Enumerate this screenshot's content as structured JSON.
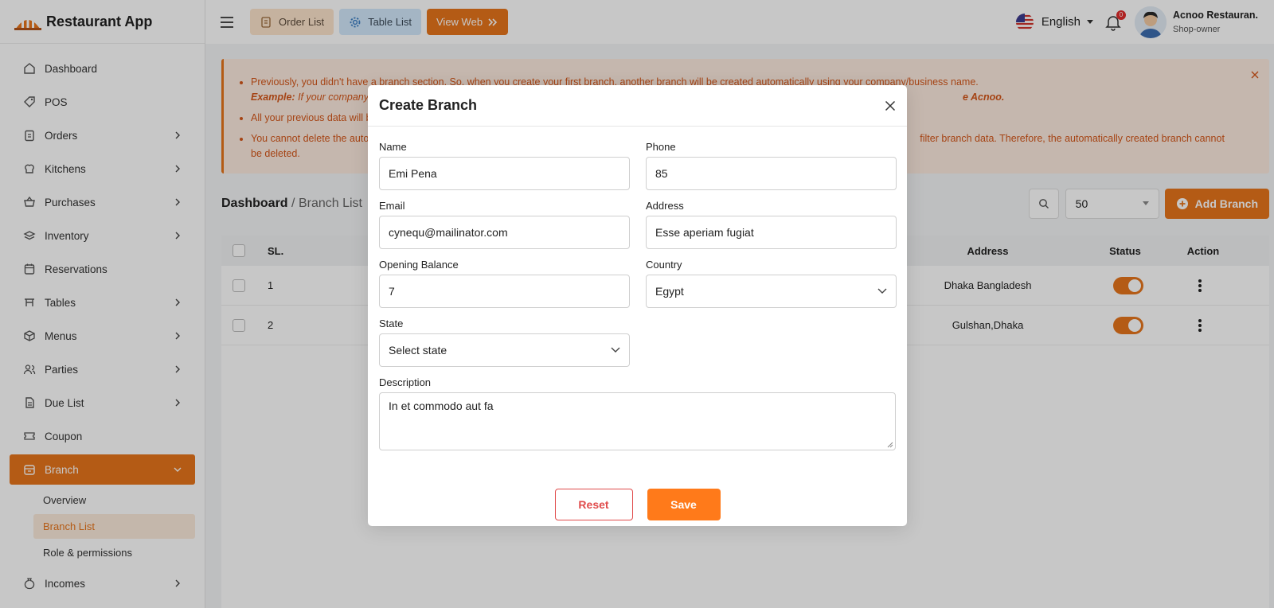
{
  "brand": {
    "name": "Restaurant App"
  },
  "sidebar": {
    "items": [
      {
        "label": "Dashboard",
        "icon": "home-icon"
      },
      {
        "label": "POS",
        "icon": "tag-icon"
      },
      {
        "label": "Orders",
        "icon": "clipboard-icon"
      },
      {
        "label": "Kitchens",
        "icon": "chef-hat-icon"
      },
      {
        "label": "Purchases",
        "icon": "basket-icon"
      },
      {
        "label": "Inventory",
        "icon": "stack-icon"
      },
      {
        "label": "Reservations",
        "icon": "calendar-icon"
      },
      {
        "label": "Tables",
        "icon": "table-icon"
      },
      {
        "label": "Menus",
        "icon": "box-icon"
      },
      {
        "label": "Parties",
        "icon": "users-icon"
      },
      {
        "label": "Due List",
        "icon": "document-icon"
      },
      {
        "label": "Coupon",
        "icon": "ticket-icon"
      },
      {
        "label": "Branch",
        "icon": "store-icon"
      },
      {
        "label": "Incomes",
        "icon": "money-bag-icon"
      }
    ],
    "branch_sub": [
      {
        "label": "Overview"
      },
      {
        "label": "Branch List"
      },
      {
        "label": "Role & permissions"
      }
    ]
  },
  "topbar": {
    "order_list": "Order List",
    "table_list": "Table List",
    "view_web": "View Web",
    "language": "English",
    "notification_count": "0",
    "user_name": "Acnoo Restauran.",
    "user_role": "Shop-owner"
  },
  "alert": {
    "line1": "Previously, you didn't have a branch section. So, when you create your first branch, another branch will be created automatically using your company/business name.",
    "line2_label": "Example:",
    "line2_text": " If your company",
    "line2_end": "e Acnoo.",
    "line3": "All your previous data will b",
    "line4_start": "You cannot delete the auto",
    "line4_end": "filter branch data. Therefore, the automatically created branch cannot be deleted."
  },
  "page": {
    "crumb_root": "Dashboard",
    "crumb_sep": "/",
    "crumb_current": "Branch List",
    "per_page": "50",
    "add_branch": "Add Branch"
  },
  "table": {
    "headers": {
      "sl": "SL.",
      "address": "Address",
      "status": "Status",
      "action": "Action"
    },
    "rows": [
      {
        "sl": "1",
        "address": "Dhaka Bangladesh"
      },
      {
        "sl": "2",
        "address": "Gulshan,Dhaka"
      }
    ]
  },
  "modal": {
    "title": "Create Branch",
    "name_label": "Name",
    "name_value": "Emi Pena",
    "phone_label": "Phone",
    "phone_value": "85",
    "email_label": "Email",
    "email_value": "cynequ@mailinator.com",
    "address_label": "Address",
    "address_value": "Esse aperiam fugiat",
    "opening_label": "Opening Balance",
    "opening_value": "7",
    "country_label": "Country",
    "country_value": "Egypt",
    "state_label": "State",
    "state_value": "Select state",
    "description_label": "Description",
    "description_value": "In et commodo aut fa",
    "reset": "Reset",
    "save": "Save"
  },
  "colors": {
    "accent": "#e7751c",
    "alert_text": "#d4571a",
    "danger": "#e04b4b"
  }
}
